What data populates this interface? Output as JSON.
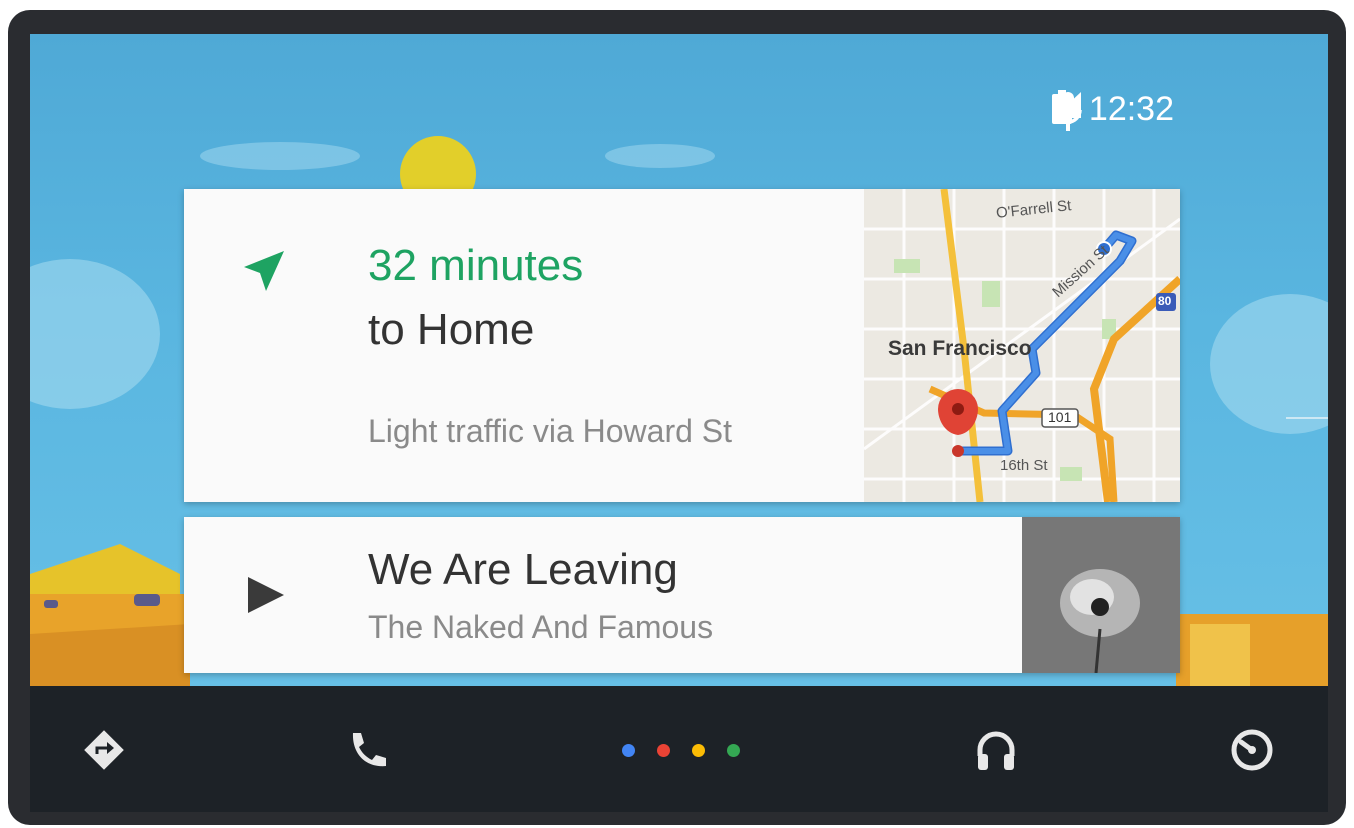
{
  "status_bar": {
    "time": "12:32",
    "signal_icon": "signal-icon",
    "battery_icon": "battery-icon",
    "mic_icon": "microphone-icon"
  },
  "navigation_card": {
    "eta": "32 minutes",
    "destination": "to Home",
    "traffic": "Light traffic via Howard St",
    "icon": "navigation-arrow-icon",
    "map": {
      "city_label": "San Francisco",
      "streets": [
        "O'Farrell St",
        "Mission St",
        "16th St"
      ],
      "highways": [
        "101",
        "80"
      ]
    }
  },
  "media_card": {
    "title": "We Are Leaving",
    "artist": "The Naked And Famous",
    "icon": "play-icon"
  },
  "bottom_nav": {
    "items": [
      {
        "name": "navigation",
        "icon": "directions-icon"
      },
      {
        "name": "phone",
        "icon": "phone-icon"
      },
      {
        "name": "home",
        "icon": "google-dots-icon"
      },
      {
        "name": "audio",
        "icon": "headphones-icon"
      },
      {
        "name": "exit",
        "icon": "exit-dial-icon"
      }
    ]
  },
  "colors": {
    "sky": "#5ab6e0",
    "eta_green": "#1ea362",
    "navbar": "#1d2227",
    "google_blue": "#4285f4",
    "google_red": "#ea4335",
    "google_yellow": "#fbbc05",
    "google_green": "#34a853",
    "route_blue": "#4a8fe7",
    "pin_red": "#e04335"
  }
}
